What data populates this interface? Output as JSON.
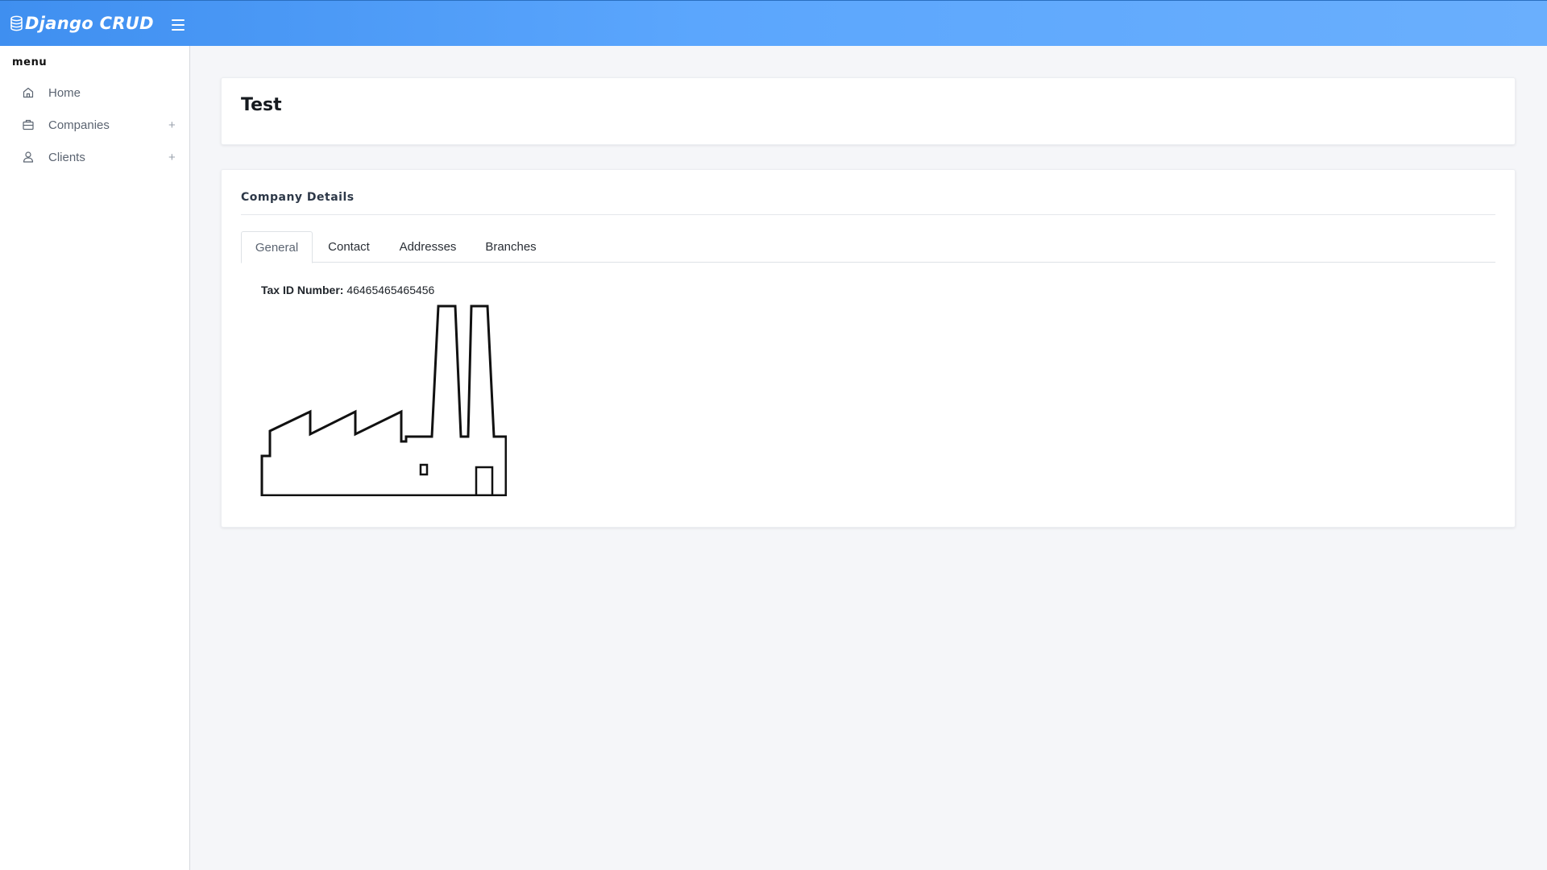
{
  "header": {
    "brand": "Django CRUD",
    "brand_icon": "database-icon",
    "menu_toggle_icon": "hamburger-icon",
    "accent_color": "#5ba6fd"
  },
  "sidebar": {
    "title": "menu",
    "items": [
      {
        "label": "Home",
        "icon": "home-icon",
        "expandable": false
      },
      {
        "label": "Companies",
        "icon": "briefcase-icon",
        "expandable": true,
        "expand_glyph": "+"
      },
      {
        "label": "Clients",
        "icon": "user-icon",
        "expandable": true,
        "expand_glyph": "+"
      }
    ]
  },
  "page": {
    "title": "Test"
  },
  "details": {
    "heading": "Company Details",
    "tabs": [
      {
        "label": "General",
        "active": true
      },
      {
        "label": "Contact",
        "active": false
      },
      {
        "label": "Addresses",
        "active": false
      },
      {
        "label": "Branches",
        "active": false
      }
    ],
    "tax_label": "Tax ID Number:",
    "tax_value": "46465465465456",
    "illustration": "factory-icon"
  }
}
